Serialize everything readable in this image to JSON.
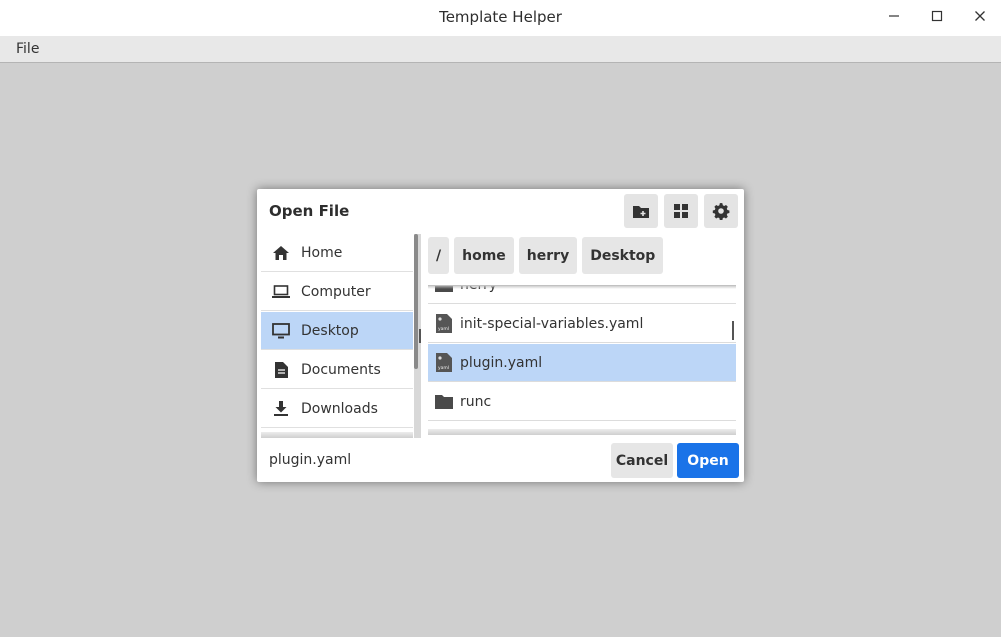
{
  "window": {
    "title": "Template Helper"
  },
  "menubar": {
    "items": [
      {
        "label": "File"
      }
    ]
  },
  "dialog": {
    "title": "Open File",
    "toolbar": {
      "new_folder_icon": "folder-plus-icon",
      "grid_view_icon": "grid-icon",
      "settings_icon": "gear-icon"
    },
    "sidebar": {
      "items": [
        {
          "label": "Home",
          "icon": "home-icon",
          "selected": false
        },
        {
          "label": "Computer",
          "icon": "laptop-icon",
          "selected": false
        },
        {
          "label": "Desktop",
          "icon": "monitor-icon",
          "selected": true
        },
        {
          "label": "Documents",
          "icon": "document-icon",
          "selected": false
        },
        {
          "label": "Downloads",
          "icon": "download-icon",
          "selected": false
        }
      ]
    },
    "path": [
      {
        "label": "/"
      },
      {
        "label": "home"
      },
      {
        "label": "herry"
      },
      {
        "label": "Desktop"
      }
    ],
    "files": [
      {
        "name": "herry",
        "icon": "folder-icon",
        "selected": false
      },
      {
        "name": "init-special-variables.yaml",
        "icon": "yaml-file-icon",
        "selected": false
      },
      {
        "name": "plugin.yaml",
        "icon": "yaml-file-icon",
        "selected": true
      },
      {
        "name": "runc",
        "icon": "folder-icon",
        "selected": false
      }
    ],
    "filename_value": "plugin.yaml",
    "cancel_label": "Cancel",
    "open_label": "Open",
    "accent_color": "#1a73e8",
    "selection_color": "#bcd6f7"
  }
}
